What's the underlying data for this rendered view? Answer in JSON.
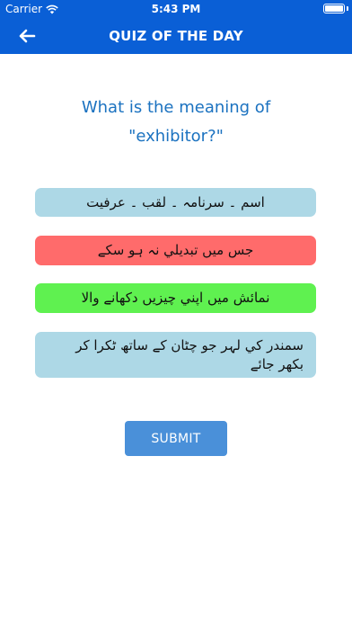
{
  "status_bar": {
    "carrier": "Carrier",
    "time": "5:43 PM",
    "battery_level": 1.0
  },
  "nav": {
    "title": "QUIZ OF THE DAY",
    "back_icon": "arrow-left-icon"
  },
  "quiz": {
    "question_line1": "What is the meaning of",
    "question_line2": "\"exhibitor?\"",
    "options": [
      {
        "label": "اسم ۔ سرنامہ ۔ لقب ۔ عرفیت",
        "state": "neutral",
        "color": "#add8e6"
      },
      {
        "label": "جس ميں تبديلي نہ ہو سکے",
        "state": "incorrect",
        "color": "#ff6b6b"
      },
      {
        "label": "نمائش ميں اپني چيزيں دکھانے والا",
        "state": "correct",
        "color": "#5ff150"
      },
      {
        "label": "سمندر کي لہر جو چٹان کے ساتھ ٹکرا کر بکھر جائے",
        "state": "neutral",
        "color": "#add8e6"
      }
    ]
  },
  "submit": {
    "label": "SUBMIT",
    "color": "#4a90d9"
  },
  "colors": {
    "header": "#0a5fd6",
    "question_text": "#1b72c0"
  }
}
